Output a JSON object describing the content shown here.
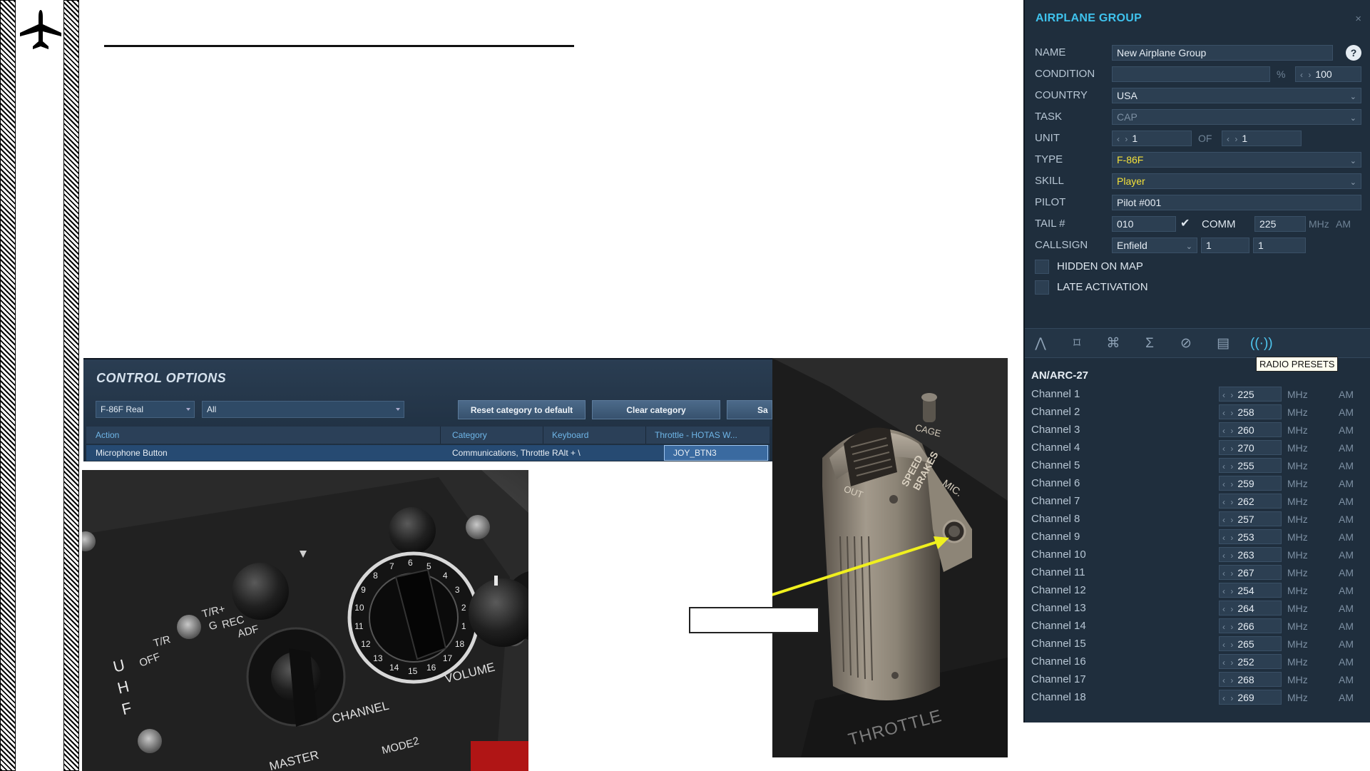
{
  "sidebar": {
    "icon": "airplane-icon"
  },
  "control_options": {
    "title": "CONTROL OPTIONS",
    "aircraft_select": "F-86F Real",
    "category_select": "All",
    "reset_label": "Reset category to default",
    "clear_label": "Clear category",
    "save_label": "Sa",
    "columns": [
      "Action",
      "Category",
      "Keyboard",
      "Throttle - HOTAS W..."
    ],
    "row": {
      "action": "Microphone Button",
      "category": "Communications, Throttle",
      "keyboard": "RAlt + \\",
      "throttle": "JOY_BTN3"
    }
  },
  "uhf_photo": {
    "texts": [
      "U",
      "H",
      "F",
      "T/R",
      "OFF",
      "T/R+",
      "G",
      "REC",
      "ADF",
      "CHANNEL",
      "VOLUME",
      "MASTER",
      "MODE",
      "2"
    ],
    "dial_numbers": [
      "10",
      "9",
      "8",
      "7",
      "6",
      "5",
      "4",
      "3",
      "2",
      "1",
      "18",
      "17",
      "16",
      "15",
      "14",
      "13",
      "12",
      "11"
    ]
  },
  "throttle_photo": {
    "texts": [
      "CAGE",
      "SPEED",
      "BRAKES",
      "MIC.",
      "OUT",
      "THROTTLE"
    ],
    "arrow_color": "#f0f01e"
  },
  "airplane_group": {
    "title": "AIRPLANE GROUP",
    "close": "×",
    "help": "?",
    "labels": {
      "name": "NAME",
      "condition": "CONDITION",
      "country": "COUNTRY",
      "task": "TASK",
      "unit": "UNIT",
      "type": "TYPE",
      "skill": "SKILL",
      "pilot": "PILOT",
      "tail": "TAIL #",
      "callsign": "CALLSIGN",
      "of": "OF",
      "percent": "%",
      "comm": "COMM",
      "mhz": "MHz",
      "am": "AM"
    },
    "values": {
      "name": "New Airplane Group",
      "condition": "",
      "condition_pct": "100",
      "country": "USA",
      "task": "CAP",
      "unit": "1",
      "unit_of": "1",
      "type": "F-86F",
      "skill": "Player",
      "pilot": "Pilot #001",
      "tail": "010",
      "comm": "225",
      "callsign": "Enfield",
      "callsign_num1": "1",
      "callsign_num2": "1"
    },
    "hidden_on_map": "HIDDEN ON MAP",
    "late_activation": "LATE ACTIVATION",
    "tab_icons": [
      "route-icon",
      "triggers-icon",
      "payload-icon",
      "summary-icon",
      "failures-icon",
      "fuel-icon",
      "radio-icon"
    ],
    "tooltip": "RADIO PRESETS",
    "radio": {
      "title": "AN/ARC-27",
      "unit": "MHz",
      "mode": "AM",
      "channels": [
        {
          "name": "Channel 1",
          "freq": "225"
        },
        {
          "name": "Channel 2",
          "freq": "258"
        },
        {
          "name": "Channel 3",
          "freq": "260"
        },
        {
          "name": "Channel 4",
          "freq": "270"
        },
        {
          "name": "Channel 5",
          "freq": "255"
        },
        {
          "name": "Channel 6",
          "freq": "259"
        },
        {
          "name": "Channel 7",
          "freq": "262"
        },
        {
          "name": "Channel 8",
          "freq": "257"
        },
        {
          "name": "Channel 9",
          "freq": "253"
        },
        {
          "name": "Channel 10",
          "freq": "263"
        },
        {
          "name": "Channel 11",
          "freq": "267"
        },
        {
          "name": "Channel 12",
          "freq": "254"
        },
        {
          "name": "Channel 13",
          "freq": "264"
        },
        {
          "name": "Channel 14",
          "freq": "266"
        },
        {
          "name": "Channel 15",
          "freq": "265"
        },
        {
          "name": "Channel 16",
          "freq": "252"
        },
        {
          "name": "Channel 17",
          "freq": "268"
        },
        {
          "name": "Channel 18",
          "freq": "269"
        }
      ]
    }
  }
}
